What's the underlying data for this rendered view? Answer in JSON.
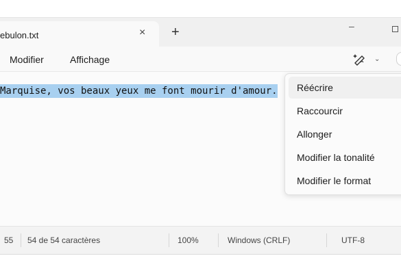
{
  "window": {
    "tab_title": "ebulon.txt",
    "tab_close": "×",
    "new_tab": "+",
    "minimize": "–"
  },
  "menubar": {
    "items": [
      "Modifier",
      "Affichage"
    ],
    "copilot_icon": "copilot-pen-icon",
    "copilot_chevron": "⌄"
  },
  "editor": {
    "text": "Marquise, vos beaux yeux me font mourir d'amour."
  },
  "rewrite_menu": {
    "options": [
      "Réécrire",
      "Raccourcir",
      "Allonger",
      "Modifier la tonalité",
      "Modifier le format"
    ],
    "active_index": 0
  },
  "statusbar": {
    "column": "55",
    "selection": "54 de 54 caractères",
    "zoom": "100%",
    "line_ending": "Windows (CRLF)",
    "encoding": "UTF-8"
  },
  "colors": {
    "selection_highlight": "#a8d0f0",
    "background": "#f9f9f9"
  }
}
